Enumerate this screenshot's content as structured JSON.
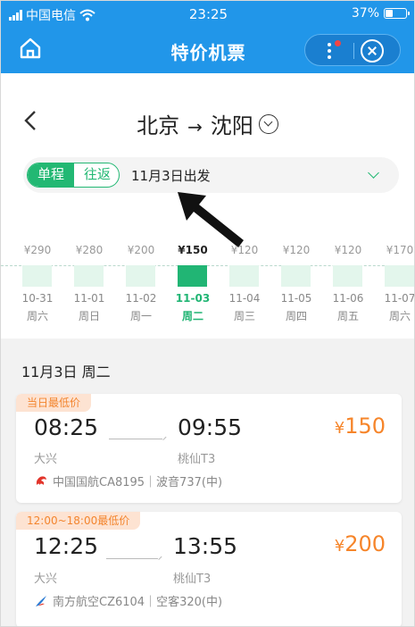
{
  "status_bar": {
    "carrier": "中国电信",
    "time": "23:25",
    "battery": "37%",
    "battery_level": 0.37
  },
  "nav": {
    "title": "特价机票",
    "icons": [
      "home-icon",
      "more-icon",
      "close-icon"
    ]
  },
  "route": {
    "from": "北京",
    "arrow": "→",
    "to": "沈阳"
  },
  "trip": {
    "one_way": "单程",
    "round_trip": "往返",
    "departure": "11月3日出发"
  },
  "dates": [
    {
      "price": "¥290",
      "date": "10-31",
      "week": "周六",
      "selected": false
    },
    {
      "price": "¥280",
      "date": "11-01",
      "week": "周日",
      "selected": false
    },
    {
      "price": "¥200",
      "date": "11-02",
      "week": "周一",
      "selected": false
    },
    {
      "price": "¥150",
      "date": "11-03",
      "week": "周二",
      "selected": true
    },
    {
      "price": "¥120",
      "date": "11-04",
      "week": "周三",
      "selected": false
    },
    {
      "price": "¥120",
      "date": "11-05",
      "week": "周四",
      "selected": false
    },
    {
      "price": "¥120",
      "date": "11-06",
      "week": "周五",
      "selected": false
    },
    {
      "price": "¥170",
      "date": "11-07",
      "week": "周六",
      "selected": false
    }
  ],
  "list": {
    "date_heading": "11月3日 周二",
    "flights": [
      {
        "badge": "当日最低价",
        "dep_time": "08:25",
        "dep_airport": "大兴",
        "arr_time": "09:55",
        "arr_airport": "桃仙T3",
        "currency": "¥",
        "price": "150",
        "airline_info": "中国国航CA8195｜波音737(中)"
      },
      {
        "badge": "12:00~18:00最低价",
        "dep_time": "12:25",
        "dep_airport": "大兴",
        "arr_time": "13:55",
        "arr_airport": "桃仙T3",
        "currency": "¥",
        "price": "200",
        "airline_info": "南方航空CZ6104｜空客320(中)"
      }
    ]
  },
  "colors": {
    "header": "#2196e9",
    "accent_green": "#21b574",
    "price_orange": "#f6852a",
    "badge_bg": "#fde3d2"
  }
}
